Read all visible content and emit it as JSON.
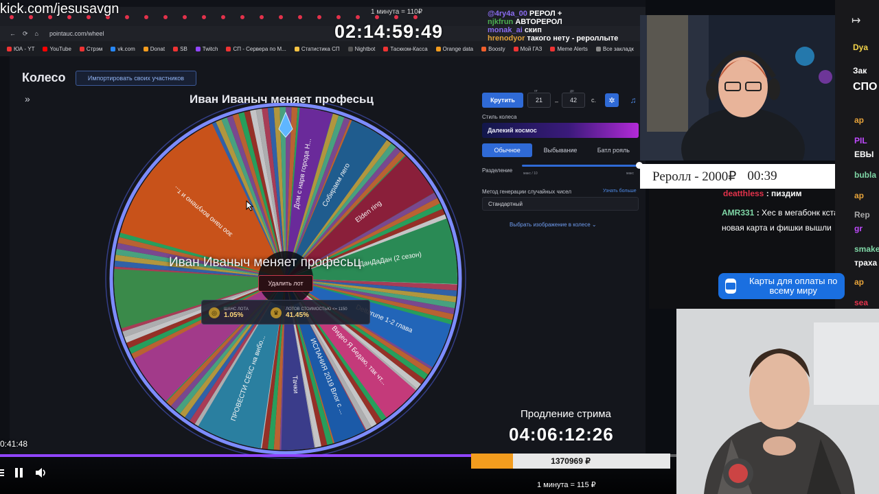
{
  "stream": {
    "channel_url": "kick.com/jesusavgn",
    "main_timer": "02:14:59:49",
    "minute_price_top": "1 минута = 110₽",
    "prolong_label": "Продление стрима",
    "prolong_timer": "04:06:12:26",
    "donation_amount": "1370969 ₽",
    "donation_progress": 0.21,
    "minute_price": "1 минута = 115 ₽"
  },
  "player": {
    "time_elapsed": "0:41:48",
    "progress": 0.7
  },
  "browser": {
    "url": "pointauc.com/wheel",
    "bookmarks": [
      {
        "label": "ЮА - YT",
        "color": "#e33"
      },
      {
        "label": "YouTube",
        "color": "#f00"
      },
      {
        "label": "Стрэм",
        "color": "#e33"
      },
      {
        "label": "vk.com",
        "color": "#2787f5"
      },
      {
        "label": "Donat",
        "color": "#f39c1e"
      },
      {
        "label": "SB",
        "color": "#e33"
      },
      {
        "label": "Twitch",
        "color": "#9146ff"
      },
      {
        "label": "СП - Сервера по М...",
        "color": "#e33"
      },
      {
        "label": "Статистика СП",
        "color": "#f6c343"
      },
      {
        "label": "Nightbot",
        "color": "#555"
      },
      {
        "label": "Таскком-Касса",
        "color": "#e33"
      },
      {
        "label": "Orange data",
        "color": "#f39c1e"
      },
      {
        "label": "Boosty",
        "color": "#f15f2c"
      },
      {
        "label": "Мой ГАЗ",
        "color": "#e33"
      },
      {
        "label": "Meme Alerts",
        "color": "#e33"
      },
      {
        "label": "Все закладк",
        "color": "#888"
      }
    ]
  },
  "app": {
    "page_title": "Колесо",
    "import_button": "Импортировать своих участников",
    "wheel_title": "Иван Иваныч меняет професьц",
    "winner_text": "Иван Иваныч меняет професьц",
    "delete_lot": "Удалить лот",
    "stats": {
      "chance_label": "ШАНС ЛОТА",
      "chance_value": "1.05%",
      "lots_label": "ЛОТОВ СТОИМОСТЬЮ <= 1150",
      "lots_value": "41.45%"
    },
    "controls": {
      "spin_button": "Крутить",
      "from_label": "от",
      "from_value": "21",
      "to_label": "до",
      "to_value": "42",
      "seconds_unit": "с.",
      "style_label": "Стиль колеса",
      "style_value": "Далекий космос",
      "modes": [
        "Обычное",
        "Выбывание",
        "Батл рояль"
      ],
      "split_label": "Разделение",
      "split_hint": "макс / 10",
      "split_max": "макс",
      "rng_label": "Метод генерации случайных чисел",
      "learn_more": "Узнать больше",
      "rng_value": "Стандартный",
      "image_link": "Выбрать изображение в колесе"
    },
    "wheel_segments": [
      {
        "label": "зоо пано вохупено и т...",
        "color": "#c8521a",
        "size": 22
      },
      {
        "label": "Дом с нарв города Н...",
        "color": "#6a2a9a",
        "size": 5
      },
      {
        "label": "Собираем лего",
        "color": "#1f5c8e",
        "size": 6
      },
      {
        "label": "Elden ring",
        "color": "#8a1f3a",
        "size": 7
      },
      {
        "label": "ДанДаДан (2 сезон)",
        "color": "#2a8a55",
        "size": 10
      },
      {
        "label": "Deltarune 1-2 глава",
        "color": "#2265b8",
        "size": 7
      },
      {
        "label": "Видео Я Бедаю, так чт...",
        "color": "#c43a7a",
        "size": 6
      },
      {
        "label": "ИСПАНИЯ 2019 Влог с ...",
        "color": "#1b5aa8",
        "size": 5
      },
      {
        "label": "Тачки",
        "color": "#3a3c8a",
        "size": 5
      },
      {
        "label": "ПРОВЕСТИ СЕКС на вибо...",
        "color": "#2a7fa0",
        "size": 10
      },
      {
        "label": "",
        "color": "#a23a8a",
        "size": 8
      },
      {
        "label": "",
        "color": "#3a8a4a",
        "size": 9
      }
    ]
  },
  "overlay_chat": [
    {
      "user": "@4ry4a_00",
      "text": "РЕРОЛ +",
      "color": "#8a6cf0"
    },
    {
      "user": "njkfrun",
      "text": "АВТОРЕРОЛ",
      "color": "#4caf50"
    },
    {
      "user": "monak_ai",
      "text": "скип",
      "color": "#8a6cf0"
    },
    {
      "user": "hrenodyor",
      "text": "такого нету - рероллыте",
      "color": "#e3a33a"
    }
  ],
  "reroll_banner": "Реролл - 2000₽",
  "reroll_timer": "00:39",
  "chat_lines": [
    {
      "user": "deatthless",
      "text": "пиздим",
      "color": "#e3324b"
    },
    {
      "user": "AMR331",
      "text": "Хес в мегабонк кстати новая карта и фишки вышли",
      "color": "#7fd6a6"
    }
  ],
  "chat_sidebar": [
    "Dya",
    "Зак",
    "СПО",
    "ар",
    "PIL",
    "ЕВЫ",
    "bubla",
    "ар",
    "Rep",
    "gr",
    "smake",
    "траха",
    "ар",
    "sea"
  ],
  "card_ad": "Карты для оплаты по всему миру"
}
